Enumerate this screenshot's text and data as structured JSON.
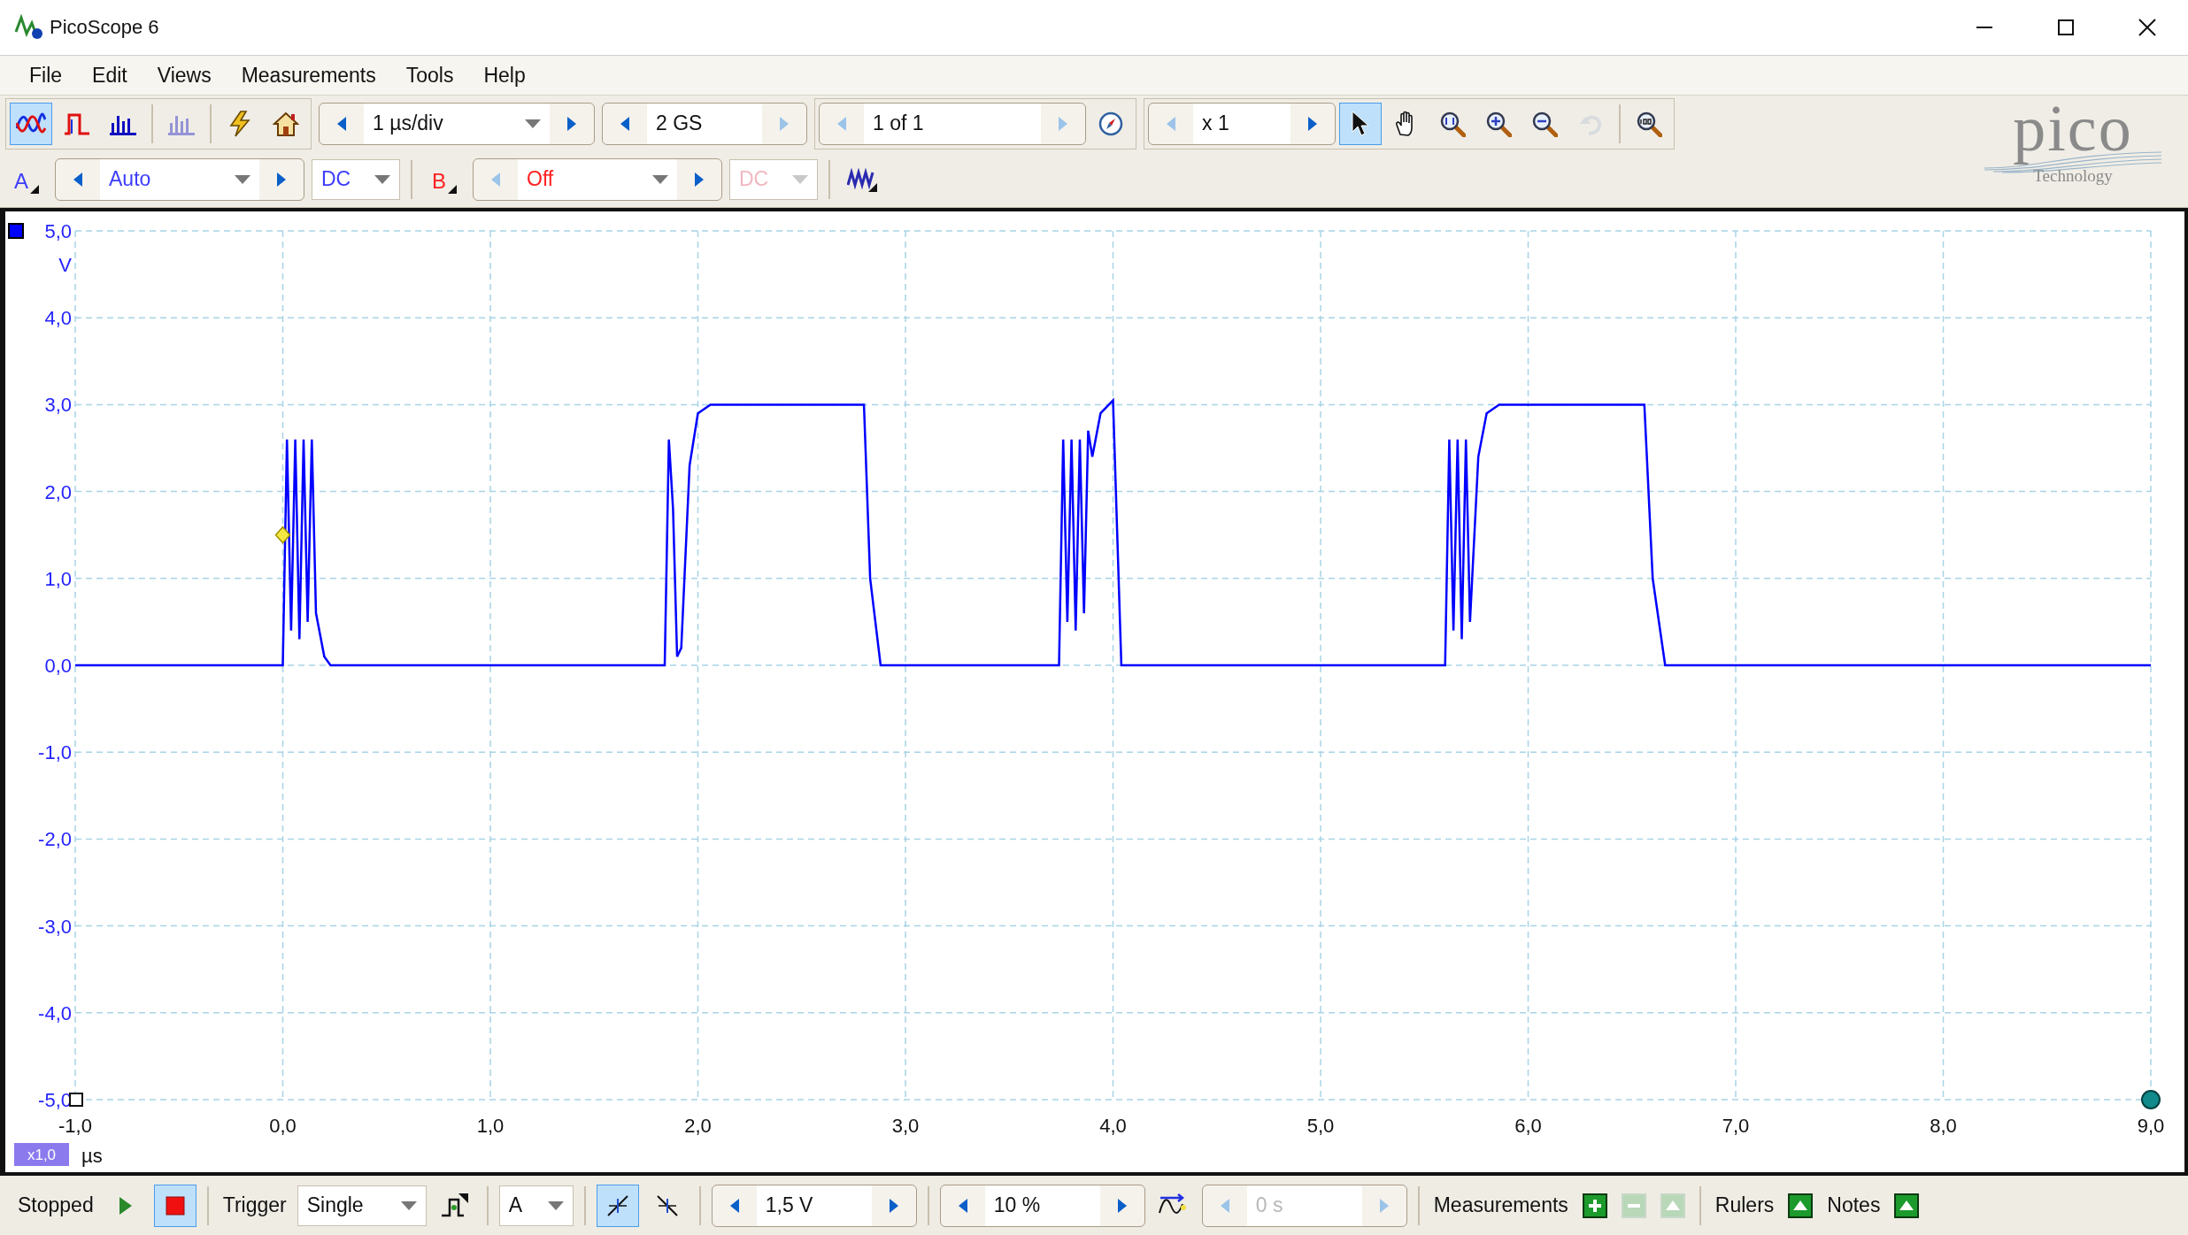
{
  "window": {
    "title": "PicoScope 6"
  },
  "menu": [
    {
      "label": "File"
    },
    {
      "label": "Edit"
    },
    {
      "label": "Views"
    },
    {
      "label": "Measurements"
    },
    {
      "label": "Tools"
    },
    {
      "label": "Help"
    }
  ],
  "toolbar": {
    "modes": [
      {
        "kind": "scope",
        "selected": true,
        "disabled": false
      },
      {
        "kind": "persistence",
        "selected": false,
        "disabled": false
      },
      {
        "kind": "spectrum",
        "selected": false,
        "disabled": false
      },
      {
        "kind": "spectrum",
        "selected": false,
        "disabled": true
      }
    ],
    "actions": [
      {
        "kind": "auto-setup"
      },
      {
        "kind": "home"
      }
    ],
    "timebase": {
      "value": "1 µs/div",
      "dropdown": true,
      "prev_enabled": true,
      "next_enabled": true
    },
    "samples": {
      "value": "2 GS",
      "dropdown": false,
      "prev_enabled": true,
      "next_enabled": false
    },
    "buffer": {
      "value": "1 of 1",
      "dropdown": false,
      "prev_enabled": false,
      "next_enabled": false
    },
    "zoom_factor": {
      "value": "x 1",
      "dropdown": false,
      "prev_enabled": false,
      "next_enabled": true
    },
    "tools": [
      {
        "kind": "pointer",
        "selected": true,
        "disabled": false
      },
      {
        "kind": "hand",
        "selected": false,
        "disabled": false
      },
      {
        "kind": "zoom-fit",
        "selected": false,
        "disabled": false
      },
      {
        "kind": "zoom-in",
        "selected": false,
        "disabled": false
      },
      {
        "kind": "zoom-out",
        "selected": false,
        "disabled": false
      },
      {
        "kind": "undo",
        "selected": false,
        "disabled": true
      },
      {
        "kind": "zoom-100",
        "selected": false,
        "disabled": false
      }
    ]
  },
  "logo": {
    "name": "pico",
    "tagline": "Technology"
  },
  "channels": [
    {
      "label": "A",
      "color": "#3c3cff",
      "range": {
        "value": "Auto",
        "dropdown": true,
        "prev_enabled": true,
        "next_enabled": true
      },
      "coupling": {
        "value": "DC",
        "disabled": false
      }
    },
    {
      "label": "B",
      "color": "#ff2020",
      "range": {
        "value": "Off",
        "dropdown": true,
        "prev_enabled": false,
        "next_enabled": true
      },
      "coupling": {
        "value": "DC",
        "disabled": true
      }
    }
  ],
  "chart": {
    "scale_badge": "x1,0",
    "chart_data": {
      "type": "line",
      "xlabel": "µs",
      "ylabel": "V",
      "xlim": [
        -1,
        9
      ],
      "ylim": [
        -5,
        5
      ],
      "xticks": [
        {
          "value": -1,
          "label": "-1,0"
        },
        {
          "value": 0,
          "label": "0,0"
        },
        {
          "value": 1,
          "label": "1,0"
        },
        {
          "value": 2,
          "label": "2,0"
        },
        {
          "value": 3,
          "label": "3,0"
        },
        {
          "value": 4,
          "label": "4,0"
        },
        {
          "value": 5,
          "label": "5,0"
        },
        {
          "value": 6,
          "label": "6,0"
        },
        {
          "value": 7,
          "label": "7,0"
        },
        {
          "value": 8,
          "label": "8,0"
        },
        {
          "value": 9,
          "label": "9,0"
        }
      ],
      "yticks": [
        {
          "value": -5,
          "label": "-5,0"
        },
        {
          "value": -4,
          "label": "-4,0"
        },
        {
          "value": -3,
          "label": "-3,0"
        },
        {
          "value": -2,
          "label": "-2,0"
        },
        {
          "value": -1,
          "label": "-1,0"
        },
        {
          "value": 0,
          "label": "0,0"
        },
        {
          "value": 1,
          "label": "1,0"
        },
        {
          "value": 2,
          "label": "2,0"
        },
        {
          "value": 3,
          "label": "3,0"
        },
        {
          "value": 4,
          "label": "4,0"
        },
        {
          "value": 5,
          "label": "5,0"
        }
      ],
      "x": [
        -1,
        0,
        0.02,
        0.04,
        0.06,
        0.08,
        0.1,
        0.12,
        0.14,
        0.16,
        0.2,
        0.23,
        1.84,
        1.86,
        1.88,
        1.9,
        1.92,
        1.96,
        2.0,
        2.06,
        2.8,
        2.83,
        2.88,
        3.74,
        3.76,
        3.78,
        3.8,
        3.82,
        3.84,
        3.86,
        3.88,
        3.9,
        3.94,
        3.98,
        4.0,
        4.04,
        5.6,
        5.62,
        5.64,
        5.66,
        5.68,
        5.7,
        5.72,
        5.76,
        5.8,
        5.86,
        6.56,
        6.6,
        6.66,
        9
      ],
      "series": [
        {
          "color": "#0000ff",
          "values": [
            0,
            0,
            2.6,
            0.4,
            2.6,
            0.3,
            2.6,
            0.5,
            2.6,
            0.6,
            0.1,
            0,
            0,
            2.6,
            1.8,
            0.1,
            0.2,
            2.3,
            2.9,
            3.0,
            3.0,
            1.0,
            0,
            0,
            2.6,
            0.5,
            2.6,
            0.4,
            2.6,
            0.6,
            2.7,
            2.4,
            2.9,
            3.0,
            3.05,
            0,
            0,
            2.6,
            0.4,
            2.6,
            0.3,
            2.6,
            0.5,
            2.4,
            2.9,
            3.0,
            3.0,
            1.0,
            0,
            0
          ]
        }
      ],
      "grid": true
    }
  },
  "status": {
    "state": "Stopped",
    "running": false,
    "trigger_label": "Trigger",
    "trigger_mode": "Single",
    "trigger_source": "A",
    "edges": [
      {
        "kind": "rising",
        "selected": true
      },
      {
        "kind": "falling",
        "selected": false
      }
    ],
    "threshold": {
      "value": "1,5 V",
      "dropdown": false,
      "prev_enabled": true,
      "next_enabled": true
    },
    "pretrigger": {
      "value": "10 %",
      "dropdown": false,
      "prev_enabled": true,
      "next_enabled": true
    },
    "delay": {
      "value": "0 s",
      "dropdown": false,
      "prev_enabled": false,
      "next_enabled": false,
      "disabled": true
    },
    "panels": [
      {
        "label": "Measurements",
        "buttons": [
          {
            "kind": "add",
            "disabled": false
          },
          {
            "kind": "remove",
            "disabled": true
          },
          {
            "kind": "up",
            "disabled": true
          }
        ]
      },
      {
        "label": "Rulers",
        "buttons": [
          {
            "kind": "up",
            "disabled": false
          }
        ]
      },
      {
        "label": "Notes",
        "buttons": [
          {
            "kind": "up",
            "disabled": false
          }
        ]
      }
    ]
  }
}
